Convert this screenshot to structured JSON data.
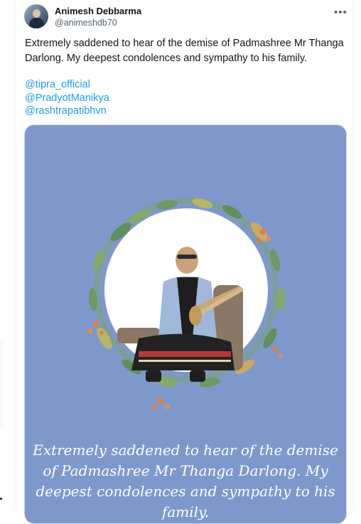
{
  "tweet": {
    "author_name": "Animesh Debbarma",
    "author_handle": "@animeshdb70",
    "more_icon": "more-horizontal-icon",
    "text": "Extremely saddened to hear of the demise of Padmashree Mr Thanga Darlong. My deepest condolences and sympathy to his family.",
    "mentions": [
      "@tipra_official",
      "@PradyotManikya",
      "@rashtrapatibhvn"
    ]
  },
  "media": {
    "caption": "Extremely saddened to hear of the demise of Padmashree Mr Thanga Darlong. My deepest condolences and sympathy to his family.",
    "background_color": "#7f98cc"
  },
  "colors": {
    "link": "#1d9bf0",
    "text": "#0f1419",
    "secondary": "#536471"
  }
}
